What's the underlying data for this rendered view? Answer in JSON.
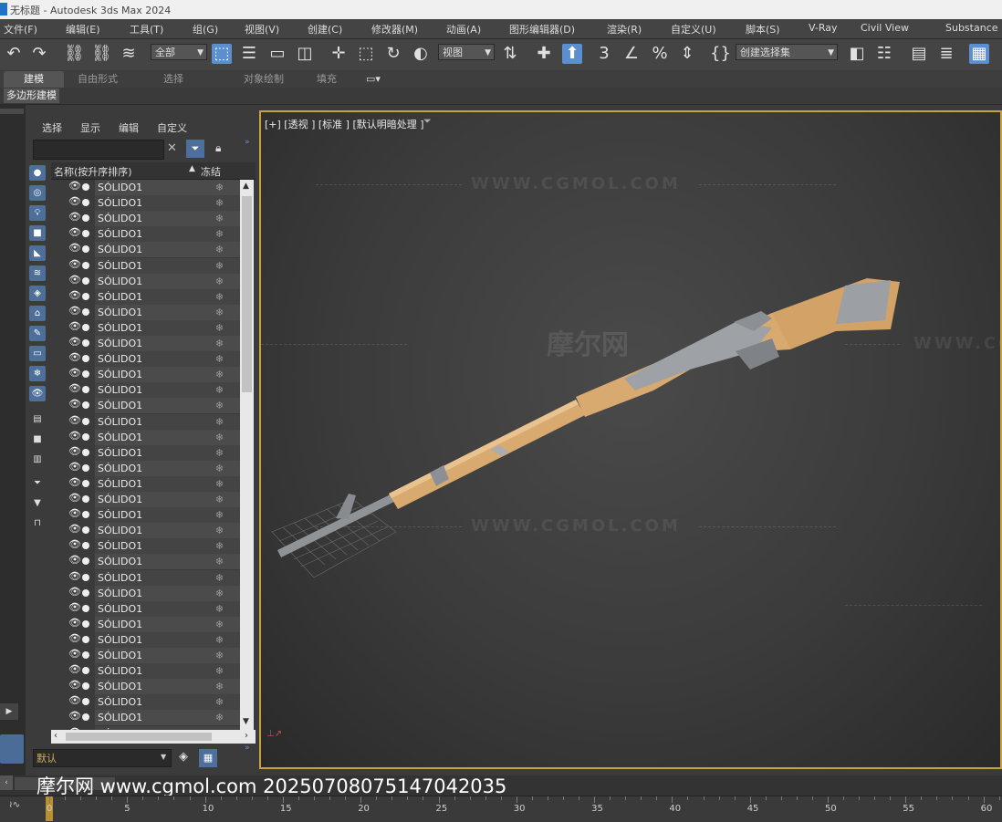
{
  "window": {
    "title": "无标题 - Autodesk 3ds Max 2024"
  },
  "menu": [
    "文件(F)",
    "编辑(E)",
    "工具(T)",
    "组(G)",
    "视图(V)",
    "创建(C)",
    "修改器(M)",
    "动画(A)",
    "图形编辑器(D)",
    "渲染(R)",
    "自定义(U)",
    "脚本(S)",
    "V-Ray",
    "Civil View",
    "Substance"
  ],
  "toolbar": {
    "selection_filter": "全部",
    "ref_coord": "视图",
    "named_selection_set": "创建选择集",
    "snap_value": "3",
    "snap_percent": "%"
  },
  "ribbon": {
    "tabs": [
      "建模",
      "自由形式",
      "选择",
      "对象绘制",
      "填充"
    ],
    "active_tab": "建模",
    "panel_label": "多边形建模"
  },
  "scene_explorer": {
    "tabs": [
      "选择",
      "显示",
      "编辑",
      "自定义"
    ],
    "search_value": "",
    "columns": {
      "name": "名称(按升序排序)",
      "frozen": "冻结"
    },
    "sort_indicator": "▲",
    "rows": [
      "SÓLIDO1",
      "SÓLIDO1",
      "SÓLIDO1",
      "SÓLIDO1",
      "SÓLIDO1",
      "SÓLIDO1",
      "SÓLIDO1",
      "SÓLIDO1",
      "SÓLIDO1",
      "SÓLIDO1",
      "SÓLIDO1",
      "SÓLIDO1",
      "SÓLIDO1",
      "SÓLIDO1",
      "SÓLIDO1",
      "SÓLIDO1",
      "SÓLIDO1",
      "SÓLIDO1",
      "SÓLIDO1",
      "SÓLIDO1",
      "SÓLIDO1",
      "SÓLIDO1",
      "SÓLIDO1",
      "SÓLIDO1",
      "SÓLIDO1",
      "SÓLIDO1",
      "SÓLIDO1",
      "SÓLIDO1",
      "SÓLIDO1",
      "SÓLIDO1",
      "SÓLIDO1",
      "SÓLIDO1",
      "SÓLIDO1",
      "SÓLIDO1",
      "SÓLIDO1",
      "SÓLIDO1"
    ],
    "layer": "默认"
  },
  "viewport": {
    "label": "[+] [透视 ] [标准 ] [默认明暗处理 ]",
    "watermarks": [
      "WWW.CGMOL.COM",
      "摩尔网",
      "WWW.CGMOL.COM",
      "WWW.CG"
    ],
    "border_color": "#c9a23f",
    "model_color": "#d9aa6f"
  },
  "status": {
    "watermark": "摩尔网 www.cgmol.com 20250708075147042035"
  },
  "timeline": {
    "ticks": [
      "0",
      "5",
      "10",
      "15",
      "20",
      "25",
      "30",
      "35",
      "40",
      "45",
      "50",
      "55",
      "60"
    ],
    "current_frame": "0"
  }
}
